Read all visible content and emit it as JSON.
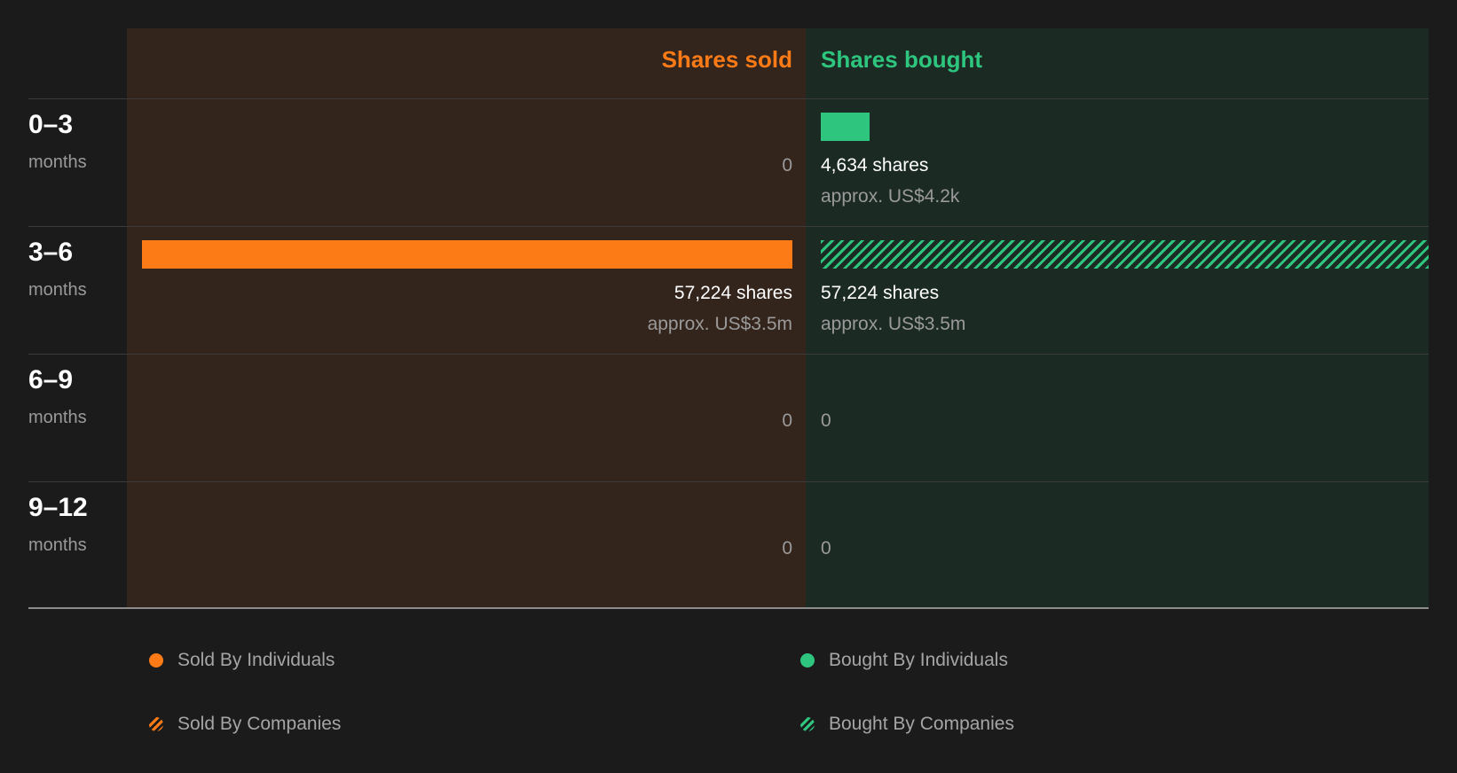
{
  "colors": {
    "sold": "#fd7b17",
    "bought": "#2ec57f",
    "sold_bg": "#33241c",
    "bought_bg": "#1c2a24",
    "page_bg": "#1b1b1b"
  },
  "chart_data": {
    "type": "bar",
    "orientation": "horizontal",
    "headers": {
      "sold": "Shares sold",
      "bought": "Shares bought"
    },
    "unit_label": "months",
    "rows": [
      {
        "period": "0–3",
        "sold": {
          "shares": 0,
          "label": "0",
          "approx": ""
        },
        "bought": {
          "shares": 4634,
          "label": "4,634 shares",
          "approx": "approx. US$4.2k",
          "by": "Individuals"
        }
      },
      {
        "period": "3–6",
        "sold": {
          "shares": 57224,
          "label": "57,224 shares",
          "approx": "approx. US$3.5m",
          "by": "Individuals"
        },
        "bought": {
          "shares": 57224,
          "label": "57,224 shares",
          "approx": "approx. US$3.5m",
          "by": "Companies"
        }
      },
      {
        "period": "6–9",
        "sold": {
          "shares": 0,
          "label": "0",
          "approx": ""
        },
        "bought": {
          "shares": 0,
          "label": "0",
          "approx": ""
        }
      },
      {
        "period": "9–12",
        "sold": {
          "shares": 0,
          "label": "0",
          "approx": ""
        },
        "bought": {
          "shares": 0,
          "label": "0",
          "approx": ""
        }
      }
    ],
    "legend": [
      {
        "label": "Sold By Individuals",
        "color": "#fd7b17",
        "style": "solid"
      },
      {
        "label": "Bought By Individuals",
        "color": "#2ec57f",
        "style": "solid"
      },
      {
        "label": "Sold By Companies",
        "color": "#fd7b17",
        "style": "hatched"
      },
      {
        "label": "Bought By Companies",
        "color": "#2ec57f",
        "style": "hatched"
      }
    ]
  }
}
